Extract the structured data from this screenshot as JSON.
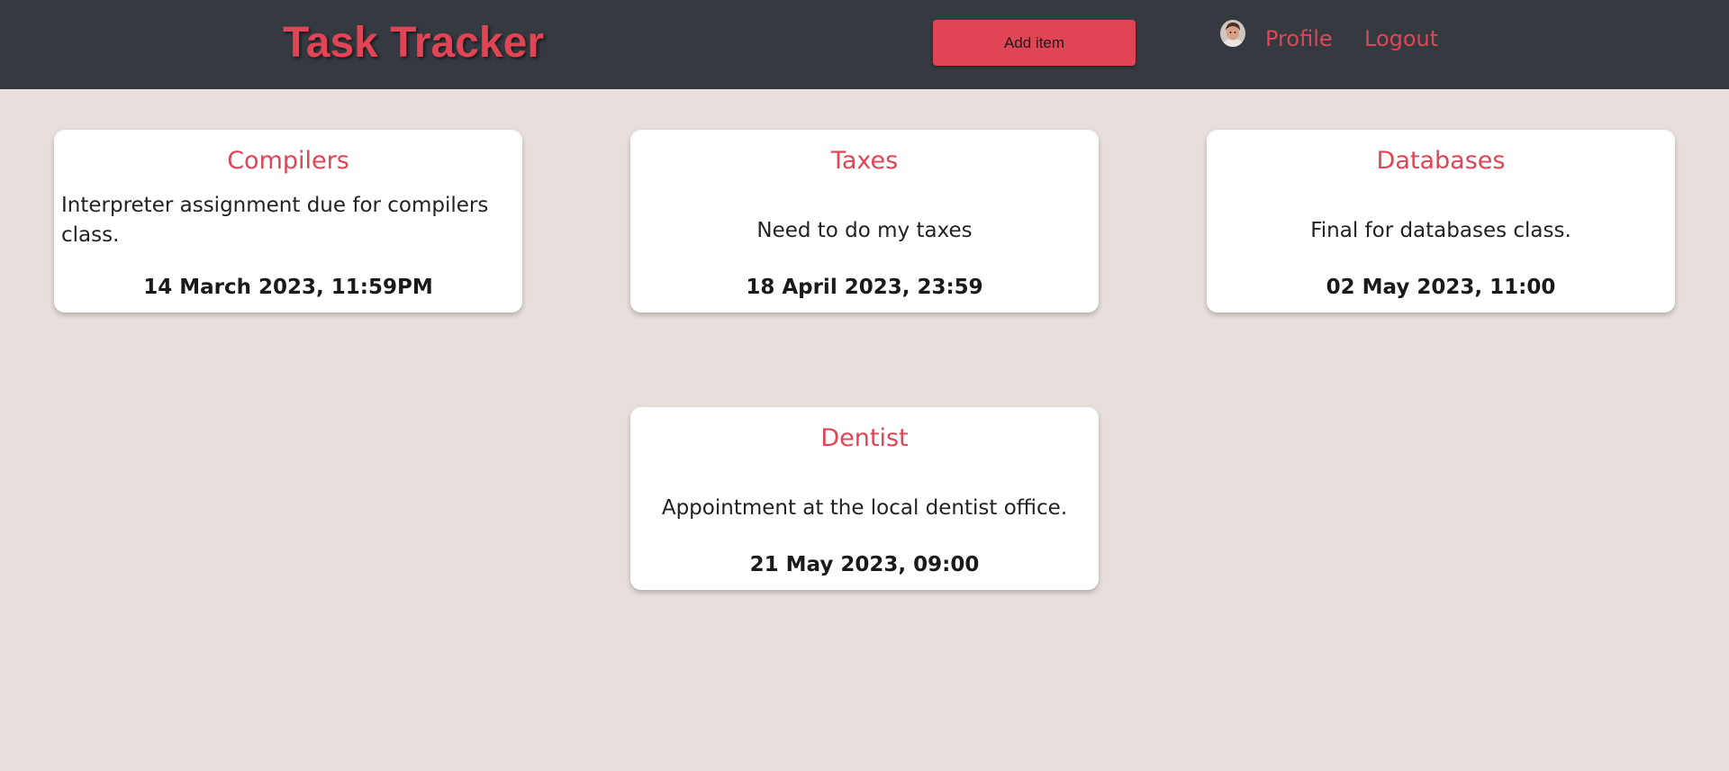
{
  "header": {
    "brand": "Task Tracker",
    "add_button_label": "Add item",
    "profile_label": "Profile",
    "logout_label": "Logout",
    "avatar_icon": "user-avatar-icon"
  },
  "colors": {
    "accent": "#e04555",
    "navbar": "#343a40",
    "background": "#e8dedb"
  },
  "tasks": [
    {
      "title": "Compilers",
      "description": "Interpreter assignment due for compilers class.",
      "due": "14 March 2023, 11:59PM"
    },
    {
      "title": "Taxes",
      "description": "Need to do my taxes",
      "due": "18 April 2023, 23:59"
    },
    {
      "title": "Databases",
      "description": "Final for databases class.",
      "due": "02 May 2023, 11:00"
    },
    {
      "title": "Dentist",
      "description": "Appointment at the local dentist office.",
      "due": "21 May 2023, 09:00"
    }
  ]
}
